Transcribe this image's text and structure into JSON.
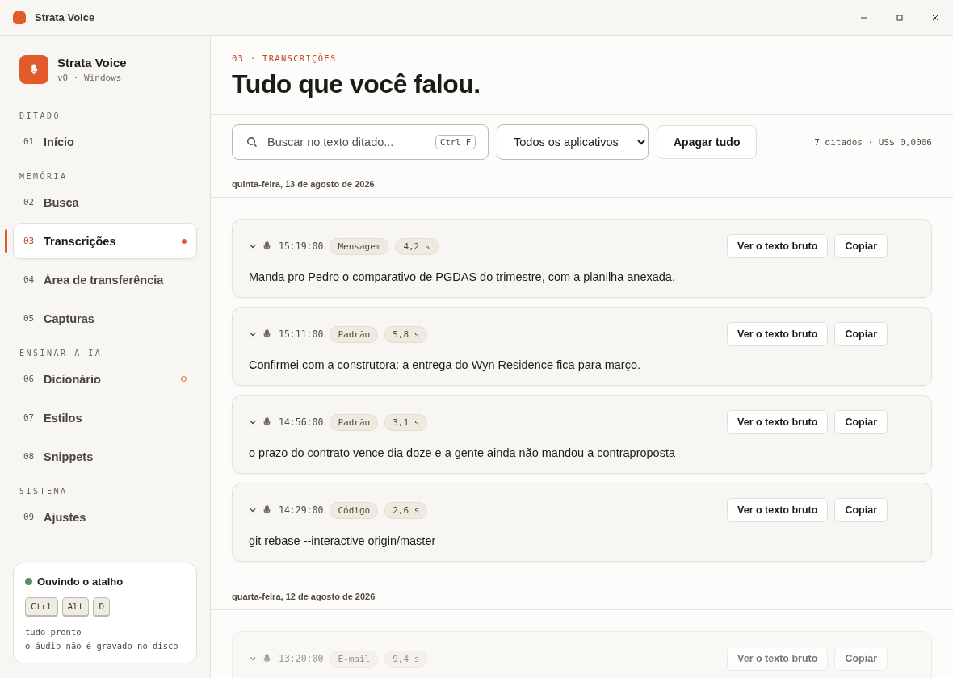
{
  "window": {
    "title": "Strata Voice"
  },
  "sidebar": {
    "app_name": "Strata Voice",
    "app_meta": "v0 · Windows",
    "sections": [
      {
        "label": "DITADO",
        "items": [
          {
            "number": "01",
            "label": "Início",
            "selected": false
          }
        ]
      },
      {
        "label": "MEMÓRIA",
        "items": [
          {
            "number": "02",
            "label": "Busca",
            "selected": false
          },
          {
            "number": "03",
            "label": "Transcrições",
            "selected": true,
            "indicator": {
              "kind": "dot"
            }
          },
          {
            "number": "04",
            "label": "Área de transferência",
            "selected": false
          },
          {
            "number": "05",
            "label": "Capturas",
            "selected": false
          }
        ]
      },
      {
        "label": "ENSINAR A IA",
        "items": [
          {
            "number": "06",
            "label": "Dicionário",
            "selected": false,
            "indicator": {
              "kind": "ring"
            }
          },
          {
            "number": "07",
            "label": "Estilos",
            "selected": false
          },
          {
            "number": "08",
            "label": "Snippets",
            "selected": false
          }
        ]
      },
      {
        "label": "SISTEMA",
        "items": [
          {
            "number": "09",
            "label": "Ajustes",
            "selected": false
          }
        ]
      }
    ],
    "status": {
      "title": "Ouvindo o atalho",
      "color": "#5a8f68",
      "keys": [
        "Ctrl",
        "Alt",
        "D"
      ],
      "lines": [
        "tudo pronto",
        "o áudio não é gravado no disco"
      ]
    }
  },
  "header": {
    "eyebrow": "03 · TRANSCRIÇÕES",
    "title": "Tudo que você falou."
  },
  "toolbar": {
    "search": {
      "placeholder": "Buscar no texto ditado...",
      "shortcut": "Ctrl F"
    },
    "filter": "Todos os aplicativos",
    "clear_button": "Apagar tudo",
    "summary": "7 ditados · US$ 0,0006"
  },
  "groups": [
    {
      "date": "quinta-feira, 13 de agosto de 2026",
      "entries": [
        {
          "time": "15:19:00",
          "style": "Mensagem",
          "duration": "4,2 s",
          "text": "Manda pro Pedro o comparativo de PGDAS do trimestre, com a planilha anexada.",
          "faded": false,
          "buttons": [
            "Ver o texto bruto",
            "Copiar"
          ]
        },
        {
          "time": "15:11:00",
          "style": "Padrão",
          "duration": "5,8 s",
          "text": "Confirmei com a construtora: a entrega do Wyn Residence fica para março.",
          "faded": false,
          "buttons": [
            "Ver o texto bruto",
            "Copiar"
          ]
        },
        {
          "time": "14:56:00",
          "style": "Padrão",
          "duration": "3,1 s",
          "text": "o prazo do contrato vence dia doze e a gente ainda não mandou a contraproposta",
          "faded": false,
          "buttons": [
            "Ver o texto bruto",
            "Copiar"
          ]
        },
        {
          "time": "14:29:00",
          "style": "Código",
          "duration": "2,6 s",
          "text": "git rebase --interactive origin/master",
          "faded": false,
          "buttons": [
            "Ver o texto bruto",
            "Copiar"
          ]
        }
      ]
    },
    {
      "date": "quarta-feira, 12 de agosto de 2026",
      "entries": [
        {
          "time": "13:20:00",
          "style": "E-mail",
          "duration": "9,4 s",
          "faded": true,
          "buttons": [
            "Ver o texto bruto",
            "Copiar"
          ]
        }
      ]
    }
  ]
}
